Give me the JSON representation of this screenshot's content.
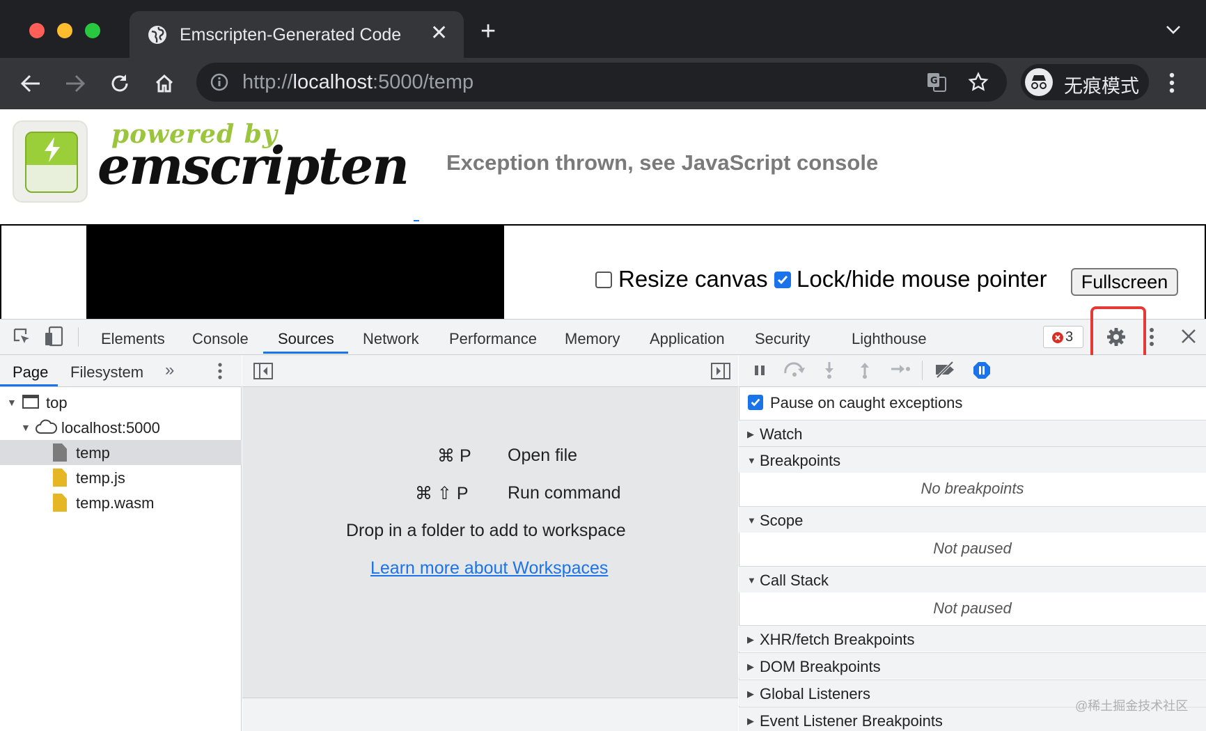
{
  "browser": {
    "tab_title": "Emscripten-Generated Code",
    "url_scheme": "http://",
    "url_host": "localhost",
    "url_rest": ":5000/temp",
    "incognito_label": "无痕模式"
  },
  "page": {
    "logo_powered": "powered by",
    "logo_name": "emscripten",
    "status": "Exception thrown, see JavaScript console",
    "resize_label": "Resize canvas",
    "lock_label": "Lock/hide mouse pointer",
    "fullscreen_label": "Fullscreen"
  },
  "devtools": {
    "tabs": [
      "Elements",
      "Console",
      "Sources",
      "Network",
      "Performance",
      "Memory",
      "Application",
      "Security",
      "Lighthouse"
    ],
    "active_tab": "Sources",
    "error_count": "3",
    "sources": {
      "subtabs": [
        "Page",
        "Filesystem"
      ],
      "tree": {
        "top": "top",
        "host": "localhost:5000",
        "files": [
          "temp",
          "temp.js",
          "temp.wasm"
        ]
      },
      "editor": {
        "open_shortcut": "⌘ P",
        "open_label": "Open file",
        "run_shortcut": "⌘ ⇧ P",
        "run_label": "Run command",
        "drop_text": "Drop in a folder to add to workspace",
        "learn_link": "Learn more about Workspaces"
      },
      "debugger": {
        "pause_caught": "Pause on caught exceptions",
        "watch": "Watch",
        "breakpoints": "Breakpoints",
        "no_breakpoints": "No breakpoints",
        "scope": "Scope",
        "scope_empty": "Not paused",
        "callstack": "Call Stack",
        "callstack_empty": "Not paused",
        "xhr": "XHR/fetch Breakpoints",
        "dom": "DOM Breakpoints",
        "global": "Global Listeners",
        "event": "Event Listener Breakpoints"
      }
    }
  },
  "watermark": "@稀土掘金技术社区",
  "colors": {
    "accent": "#1a73e8",
    "highlight": "#e53935",
    "logo_green": "#9bc53d"
  }
}
